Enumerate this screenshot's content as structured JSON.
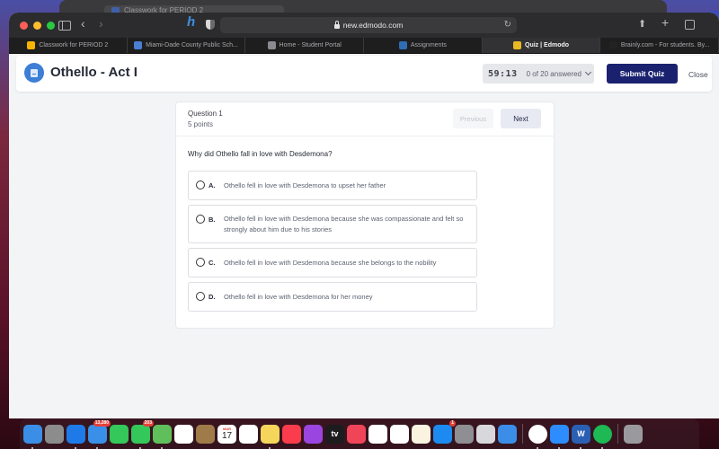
{
  "background_window": {
    "tab_title": "Classwork for PERIOD 2"
  },
  "browser": {
    "url": "new.edmodo.com",
    "tabs": [
      {
        "label": "Classwork for PERIOD 2",
        "icon": "google-classroom-icon",
        "color": "#f4b400",
        "active": false
      },
      {
        "label": "Miami-Dade County Public Sch...",
        "icon": "mdcps-icon",
        "color": "#4a7fd4",
        "active": false
      },
      {
        "label": "Home - Student Portal",
        "icon": "portal-icon",
        "color": "#8a8a90",
        "active": false
      },
      {
        "label": "Assignments",
        "icon": "w-icon",
        "color": "#2f6db5",
        "active": false
      },
      {
        "label": "Quiz | Edmodo",
        "icon": "edmodo-icon",
        "color": "#e8b923",
        "active": true
      },
      {
        "label": "Brainly.com - For students. By...",
        "icon": "brainly-icon",
        "color": "#222222",
        "active": false
      }
    ]
  },
  "quiz": {
    "title": "Othello - Act I",
    "timer": "59:13",
    "answered": "0 of 20 answered",
    "submit_label": "Submit Quiz",
    "close_label": "Close",
    "accent": "#1a2270"
  },
  "question": {
    "number_label": "Question 1",
    "points_label": "5 points",
    "previous_label": "Previous",
    "next_label": "Next",
    "text": "Why did Othello fall in love with Desdemona?",
    "options": [
      {
        "letter": "A.",
        "text": "Othello fell in love with Desdemona to upset her father",
        "selected": false
      },
      {
        "letter": "B.",
        "text": "Othello fell in love with Desdemona because she was compassionate and felt so strongly about him due to his stories",
        "selected": false
      },
      {
        "letter": "C.",
        "text": "Othello fell in love with Desdemona because she belongs to the nobility",
        "selected": false
      },
      {
        "letter": "D.",
        "text": "Othello fell in love with Desdemona for her money",
        "selected": false
      }
    ]
  },
  "dock": {
    "items": [
      {
        "name": "finder",
        "color": "#3a8ee6",
        "badge": null,
        "running": true
      },
      {
        "name": "launchpad",
        "color": "#8c8c8c",
        "badge": null,
        "running": false
      },
      {
        "name": "safari",
        "color": "#1e7ae8",
        "badge": null,
        "running": true
      },
      {
        "name": "mail",
        "color": "#3a8fe8",
        "badge": "13,280",
        "running": true
      },
      {
        "name": "facetime",
        "color": "#34c759",
        "badge": null,
        "running": false
      },
      {
        "name": "messages",
        "color": "#34c759",
        "badge": "203",
        "running": true
      },
      {
        "name": "maps",
        "color": "#5fbf5a",
        "badge": null,
        "running": true
      },
      {
        "name": "photos",
        "color": "#ffffff",
        "badge": null,
        "running": false
      },
      {
        "name": "contacts",
        "color": "#a07b4a",
        "badge": null,
        "running": false
      },
      {
        "name": "calendar",
        "color": "#ffffff",
        "badge": null,
        "running": false,
        "month": "MAR",
        "day": "17"
      },
      {
        "name": "reminders",
        "color": "#ffffff",
        "badge": null,
        "running": false
      },
      {
        "name": "notes",
        "color": "#f5d65b",
        "badge": null,
        "running": true
      },
      {
        "name": "music",
        "color": "#fa3c4c",
        "badge": null,
        "running": false
      },
      {
        "name": "podcasts",
        "color": "#9b45e0",
        "badge": null,
        "running": false
      },
      {
        "name": "apple-tv",
        "color": "#1c1c1e",
        "badge": null,
        "running": false,
        "label": "tv"
      },
      {
        "name": "news",
        "color": "#f04458",
        "badge": null,
        "running": false
      },
      {
        "name": "numbers",
        "color": "#ffffff",
        "badge": null,
        "running": false
      },
      {
        "name": "keynote",
        "color": "#ffffff",
        "badge": null,
        "running": false
      },
      {
        "name": "pages",
        "color": "#f9f3e0",
        "badge": null,
        "running": false
      },
      {
        "name": "app-store",
        "color": "#1c8af0",
        "badge": "1",
        "running": false
      },
      {
        "name": "system-preferences",
        "color": "#8e8e93",
        "badge": null,
        "running": false
      },
      {
        "name": "roblox",
        "color": "#d8d8dc",
        "badge": null,
        "running": false
      },
      {
        "name": "roblox-studio",
        "color": "#3b8de8",
        "badge": null,
        "running": false
      },
      {
        "separator": true
      },
      {
        "name": "chrome",
        "color": "#ffffff",
        "badge": null,
        "running": true
      },
      {
        "name": "zoom",
        "color": "#2d8cff",
        "badge": null,
        "running": true
      },
      {
        "name": "word",
        "color": "#2b5fb4",
        "badge": null,
        "running": true,
        "label": "W"
      },
      {
        "name": "spotify",
        "color": "#1db954",
        "badge": null,
        "running": true
      },
      {
        "separator": true
      },
      {
        "name": "trash",
        "color": "#9a9a9e",
        "badge": null,
        "running": false
      }
    ]
  }
}
